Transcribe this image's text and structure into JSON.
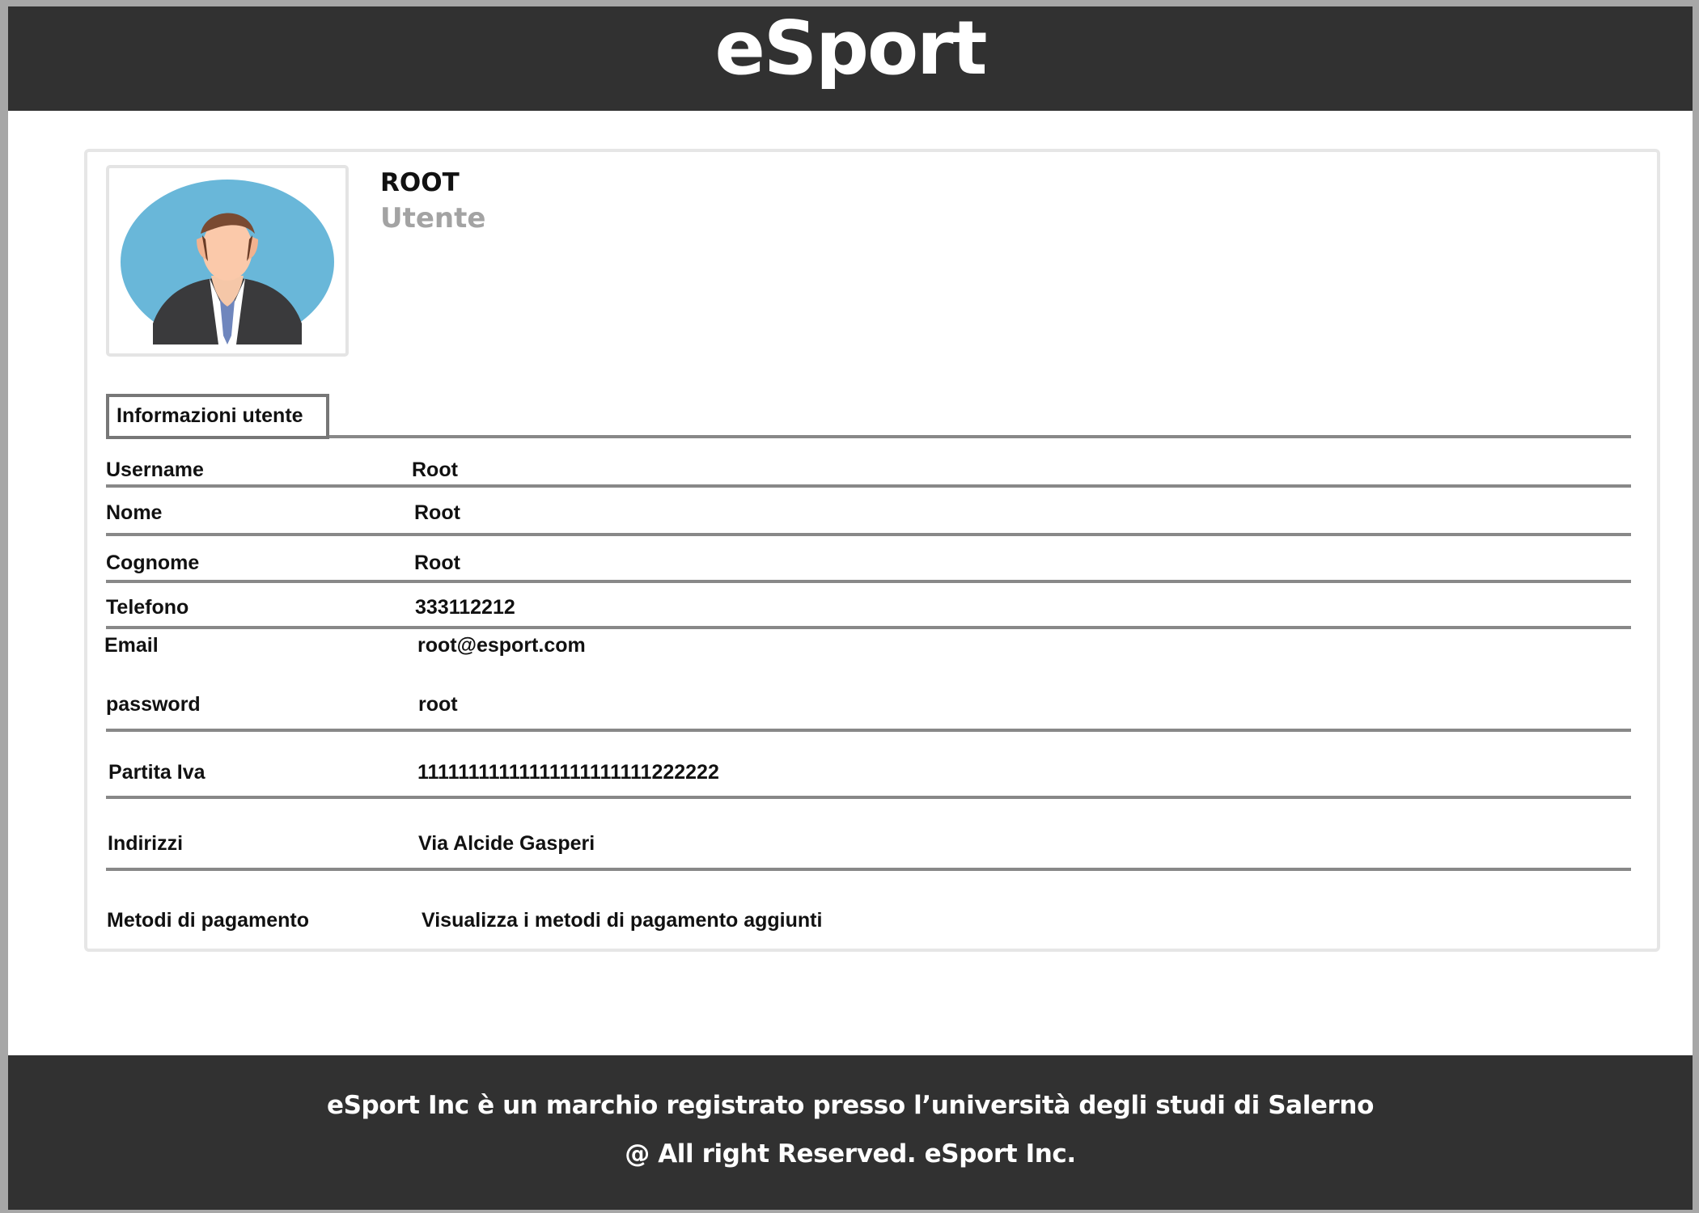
{
  "app": {
    "title": "eSport"
  },
  "profile": {
    "name": "ROOT",
    "role": "Utente",
    "avatar_icon": "user-avatar-icon"
  },
  "section": {
    "title": "Informazioni utente"
  },
  "fields": {
    "username": {
      "label": "Username",
      "value": "Root"
    },
    "nome": {
      "label": "Nome",
      "value": "Root"
    },
    "cognome": {
      "label": "Cognome",
      "value": "Root"
    },
    "telefono": {
      "label": "Telefono",
      "value": "333112212"
    },
    "email": {
      "label": "Email",
      "value": "root@esport.com"
    },
    "password": {
      "label": "password",
      "value": "root"
    },
    "partita_iva": {
      "label": "Partita Iva",
      "value": "11111111111111111111111222222"
    },
    "indirizzi": {
      "label": "Indirizzi",
      "value": "Via Alcide Gasperi"
    },
    "metodi_pagamento": {
      "label": "Metodi di pagamento",
      "value": "Visualizza i metodi di pagamento aggiunti"
    }
  },
  "footer": {
    "line1": "eSport Inc è un marchio registrato presso l’università degli studi di Salerno",
    "line2": "@ All right Reserved. eSport Inc."
  },
  "colors": {
    "header_background": "#313131",
    "footer_background": "#313131",
    "card_border": "#e6e6e6",
    "line": "#888888",
    "muted_text": "#a3a3a3",
    "avatar_background": "#69b7d9"
  }
}
